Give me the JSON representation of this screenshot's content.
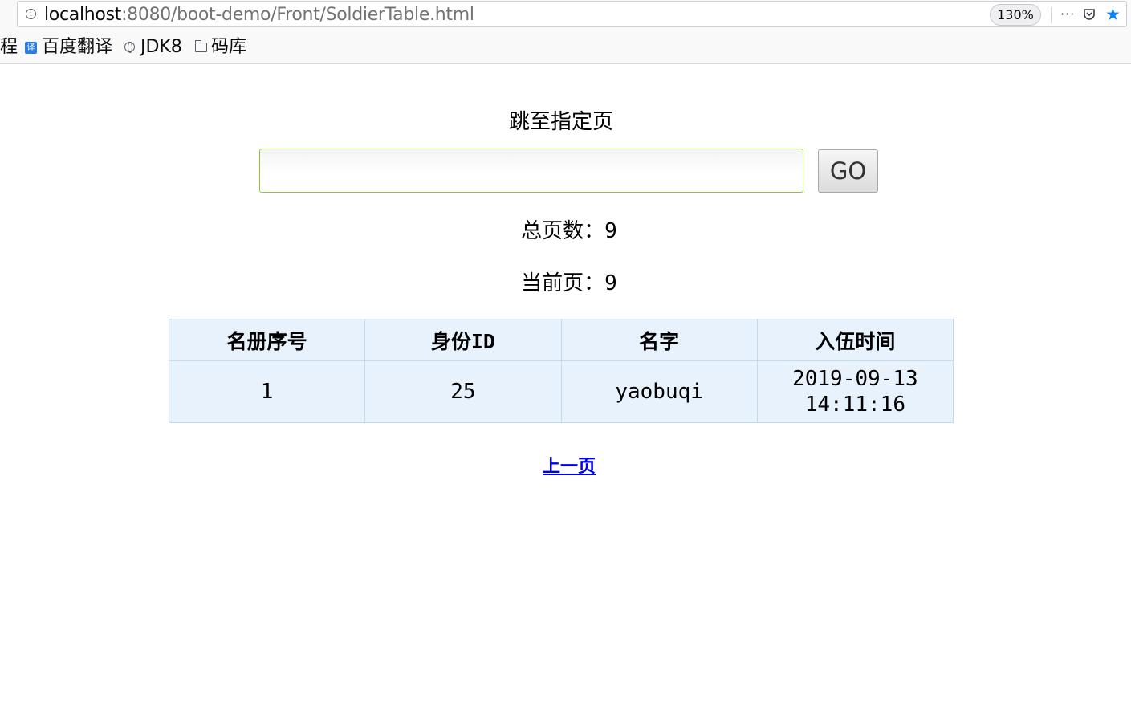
{
  "browser": {
    "url_host": "localhost",
    "url_path": ":8080/boot-demo/Front/SoldierTable.html",
    "zoom": "130%",
    "more_icon": "···"
  },
  "bookmarks": [
    {
      "label": "程",
      "icon": "none"
    },
    {
      "label": "百度翻译",
      "icon": "translate-icon",
      "icon_text": "译"
    },
    {
      "label": "JDK8",
      "icon": "globe-icon"
    },
    {
      "label": "码库",
      "icon": "folder-icon"
    }
  ],
  "jump": {
    "title": "跳至指定页",
    "input_value": "",
    "go_label": "GO"
  },
  "stats": {
    "total_label": "总页数：",
    "total_value": "9",
    "current_label": "当前页：",
    "current_value": "9"
  },
  "table": {
    "headers": [
      "名册序号",
      "身份ID",
      "名字",
      "入伍时间"
    ],
    "rows": [
      [
        "1",
        "25",
        "yaobuqi",
        "2019-09-13 14:11:16"
      ]
    ]
  },
  "pagination": {
    "prev_label": "上一页"
  },
  "colors": {
    "table_bg": "#e8f2fc",
    "input_border": "#8cc63f",
    "link": "#0000ee",
    "star": "#0a84ff"
  }
}
